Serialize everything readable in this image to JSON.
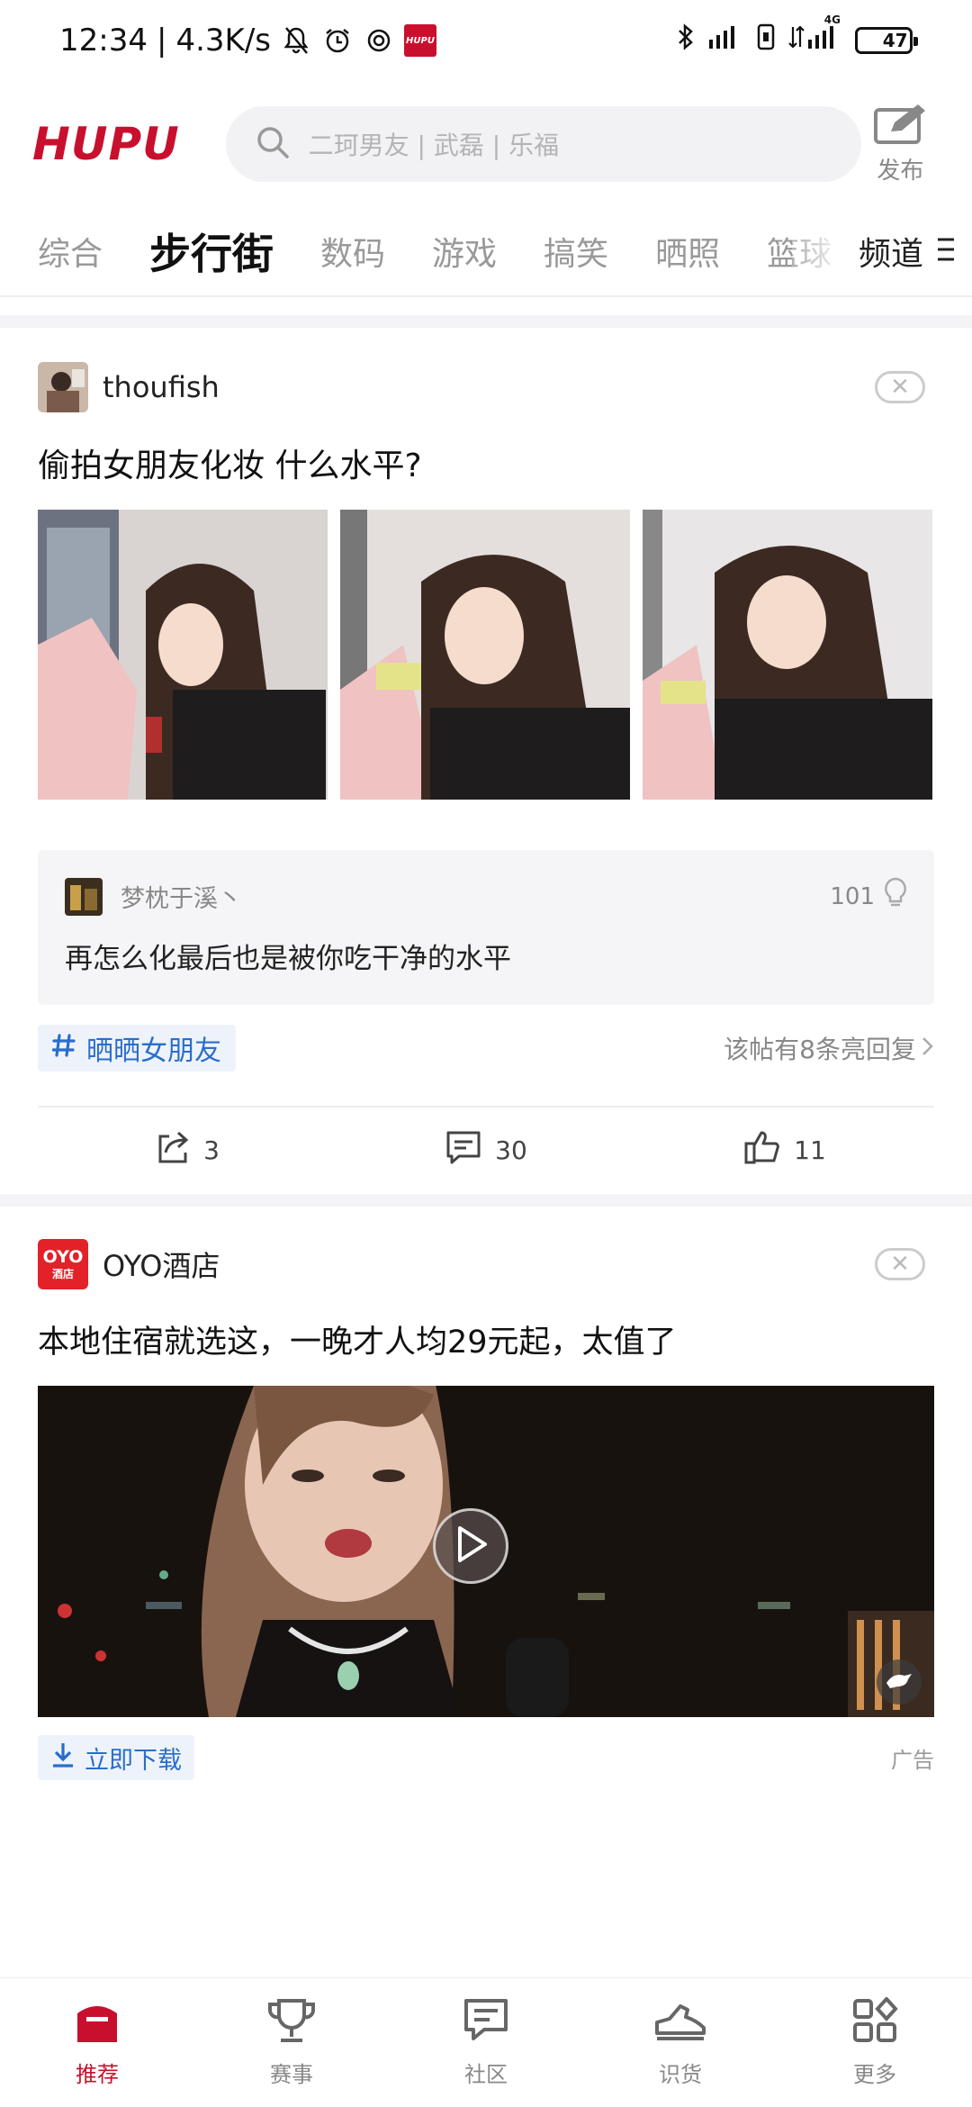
{
  "status_bar": {
    "time": "12:34",
    "speed": "4.3K/s",
    "app_badge": "HUPU",
    "network_label": "4G",
    "battery": "47"
  },
  "header": {
    "logo": "HUPU",
    "search_placeholder": "二珂男友 | 武磊 | 乐福",
    "publish_label": "发布"
  },
  "tabs": {
    "items": [
      "综合",
      "步行街",
      "数码",
      "游戏",
      "搞笑",
      "晒照",
      "篮球"
    ],
    "active_index": 1,
    "channel_label": "频道"
  },
  "post": {
    "username": "thoufish",
    "title": "偷拍女朋友化妆  什么水平?",
    "hot_comment": {
      "user": "梦枕于溪丶",
      "likes": "101",
      "text": "再怎么化最后也是被你吃干净的水平"
    },
    "tag": "晒晒女朋友",
    "reply_note": "该帖有8条亮回复",
    "actions": {
      "share": "3",
      "comment": "30",
      "like": "11"
    }
  },
  "ad": {
    "brand_logo_line1": "OYO",
    "brand_logo_line2": "酒店",
    "brand_name": "OYO酒店",
    "title": "本地住宿就选这，一晚才人均29元起，太值了",
    "download_label": "立即下载",
    "ad_label": "广告"
  },
  "bottom_nav": {
    "items": [
      {
        "label": "推荐",
        "icon": "home-icon"
      },
      {
        "label": "赛事",
        "icon": "trophy-icon"
      },
      {
        "label": "社区",
        "icon": "chat-icon"
      },
      {
        "label": "识货",
        "icon": "sneaker-icon"
      },
      {
        "label": "更多",
        "icon": "grid-icon"
      }
    ],
    "active_index": 0
  },
  "colors": {
    "brand_red": "#c8102e",
    "link_blue": "#2a6dcc"
  }
}
